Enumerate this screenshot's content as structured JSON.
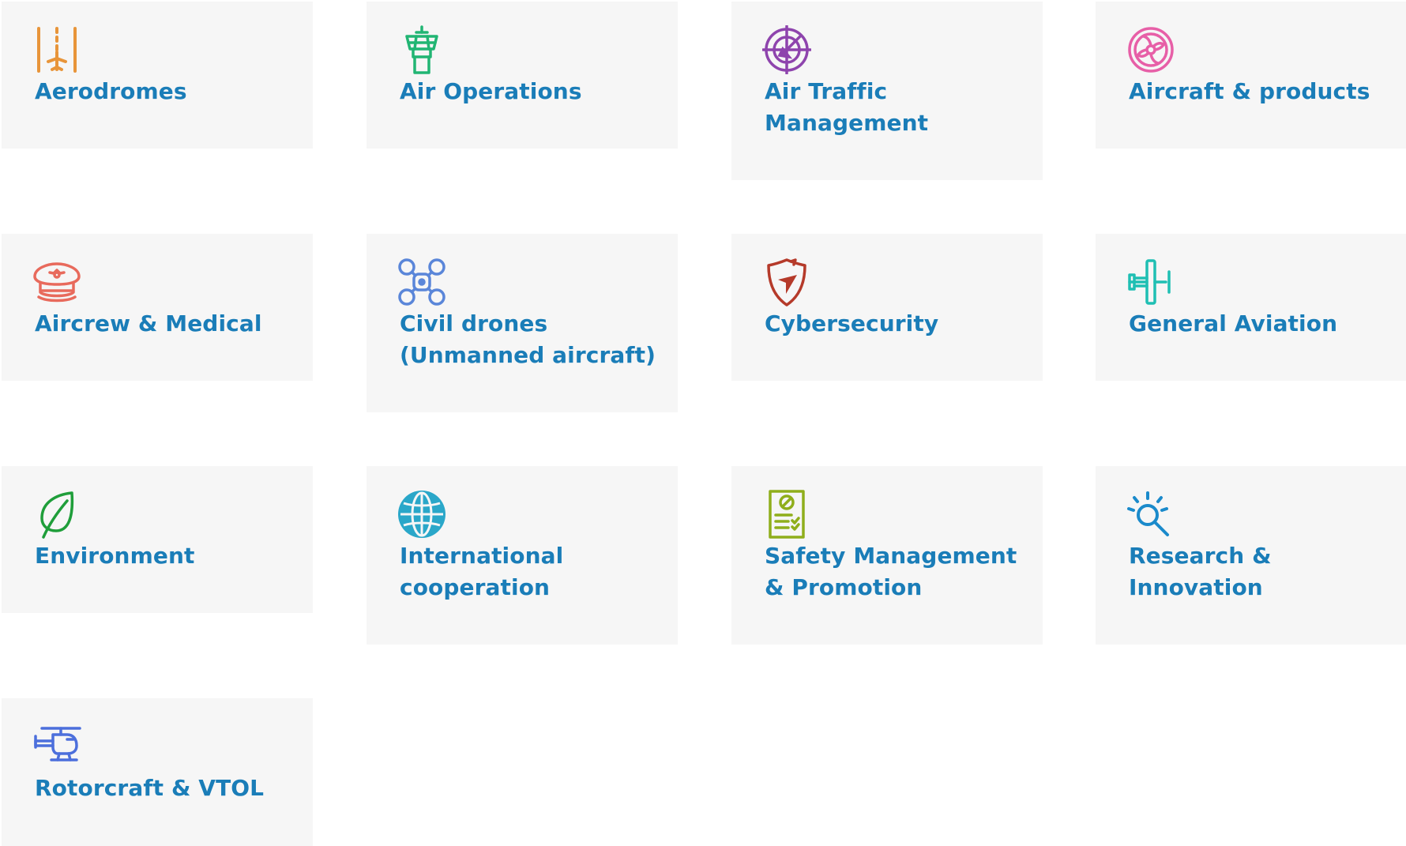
{
  "tiles": [
    {
      "id": "aerodromes",
      "label": "Aerodromes",
      "icon": "runway-icon",
      "color": "#e8953a"
    },
    {
      "id": "air-operations",
      "label": "Air Operations",
      "icon": "control-tower-icon",
      "color": "#21b573"
    },
    {
      "id": "air-traffic-management",
      "label": "Air Traffic Management",
      "icon": "radar-icon",
      "color": "#8e44ad"
    },
    {
      "id": "aircraft-products",
      "label": "Aircraft & products",
      "icon": "turbine-icon",
      "color": "#e75fa7"
    },
    {
      "id": "aircrew-medical",
      "label": "Aircrew & Medical",
      "icon": "pilot-cap-icon",
      "color": "#e86a5c"
    },
    {
      "id": "civil-drones",
      "label": "Civil drones (Unmanned aircraft)",
      "icon": "drone-icon",
      "color": "#5a86d9"
    },
    {
      "id": "cybersecurity",
      "label": "Cybersecurity",
      "icon": "shield-icon",
      "color": "#b53a2a"
    },
    {
      "id": "general-aviation",
      "label": "General Aviation",
      "icon": "propeller-plane-icon",
      "color": "#1fbfb3"
    },
    {
      "id": "environment",
      "label": "Environment",
      "icon": "leaf-icon",
      "color": "#1f9e3a"
    },
    {
      "id": "international-cooperation",
      "label": "International cooperation",
      "icon": "globe-icon",
      "color": "#2aa7c9"
    },
    {
      "id": "safety-management",
      "label": "Safety Management & Promotion",
      "icon": "checklist-icon",
      "color": "#8fae1b"
    },
    {
      "id": "research-innovation",
      "label": "Research & Innovation",
      "icon": "magnifier-icon",
      "color": "#1a8acb"
    },
    {
      "id": "rotorcraft-vtol",
      "label": "Rotorcraft & VTOL",
      "icon": "helicopter-icon",
      "color": "#4c6fdc"
    }
  ],
  "label_color": "#1a7db8",
  "tile_background": "#f6f6f6"
}
